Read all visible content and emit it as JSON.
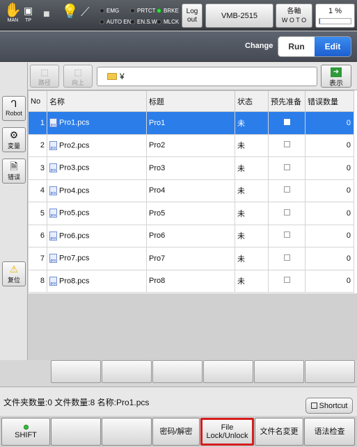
{
  "topbar": {
    "man_label": "MAN",
    "tp_label": "TP",
    "indicators": {
      "emg": "EMG",
      "prtct": "PRTCT",
      "brke": "BRKE",
      "auto_en": "AUTO EN",
      "en_sw": "EN.S.W",
      "mlck": "MLCK"
    },
    "log_out": "Log\nout",
    "model": "VMB-2515",
    "axis_top": "各軸",
    "axis_bottom": "W O T O",
    "speed_percent": "1 %",
    "speed_value": 0.01
  },
  "mode": {
    "change_label": "Change",
    "run": "Run",
    "edit": "Edit",
    "selected": "Edit",
    "colors": {
      "edit_active": "#1d5fd0",
      "selected_row": "#2b7de9"
    }
  },
  "sidebar": {
    "robot": "Robot",
    "variable": "変量",
    "error": "错误",
    "reset": "复位"
  },
  "pathbar": {
    "back_label": "路径",
    "up_label": "向上",
    "path": "¥",
    "show_label": "表示"
  },
  "table": {
    "columns": [
      "No",
      "名称",
      "标题",
      "状态",
      "预先准备",
      "错误数量"
    ],
    "rows": [
      {
        "no": "1",
        "name": "Pro1.pcs",
        "title": "Pro1",
        "status": "未",
        "count": "0",
        "selected": true
      },
      {
        "no": "2",
        "name": "Pro2.pcs",
        "title": "Pro2",
        "status": "未",
        "count": "0"
      },
      {
        "no": "3",
        "name": "Pro3.pcs",
        "title": "Pro3",
        "status": "未",
        "count": "0"
      },
      {
        "no": "4",
        "name": "Pro4.pcs",
        "title": "Pro4",
        "status": "未",
        "count": "0"
      },
      {
        "no": "5",
        "name": "Pro5.pcs",
        "title": "Pro5",
        "status": "未",
        "count": "0"
      },
      {
        "no": "6",
        "name": "Pro6.pcs",
        "title": "Pro6",
        "status": "未",
        "count": "0"
      },
      {
        "no": "7",
        "name": "Pro7.pcs",
        "title": "Pro7",
        "status": "未",
        "count": "0"
      },
      {
        "no": "8",
        "name": "Pro8.pcs",
        "title": "Pro8",
        "status": "未",
        "count": "0"
      }
    ]
  },
  "status": {
    "text": "文件夹数量:0 文件数量:8 名称:Pro1.pcs",
    "shortcut": "Shortcut"
  },
  "fkeys": {
    "shift": "SHIFT",
    "password": "密码/解密",
    "file_lock_1": "File",
    "file_lock_2": "Lock/Unlock",
    "rename": "文件名変更",
    "syntax": "语法检查"
  }
}
